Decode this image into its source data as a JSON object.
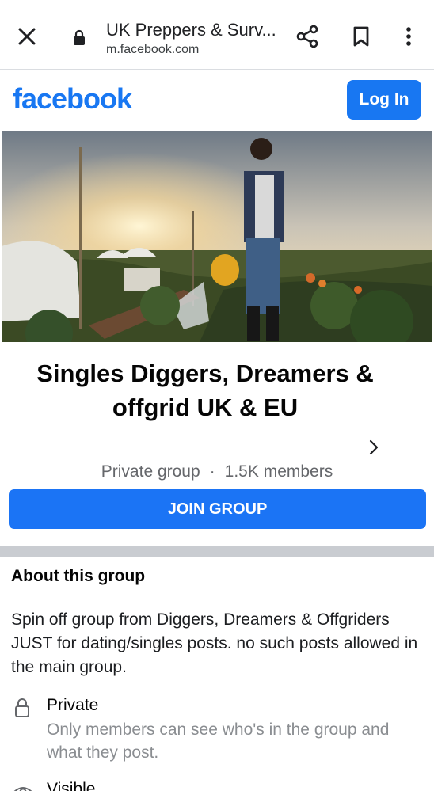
{
  "browser": {
    "title": "UK Preppers & Surv...",
    "url": "m.facebook.com",
    "icons": [
      "close-icon",
      "lock-icon",
      "share-icon",
      "bookmark-icon",
      "more-vert-icon"
    ]
  },
  "header": {
    "logo_text": "facebook",
    "login_label": "Log In",
    "brand_color": "#1877f2"
  },
  "group": {
    "title": "Singles Diggers, Dreamers & offgrid UK & EU",
    "privacy": "Private group",
    "separator": "·",
    "members": "1.5K members",
    "join_label": "JOIN GROUP"
  },
  "about": {
    "heading": "About this group",
    "description": "Spin off group from Diggers, Dreamers & Offgriders JUST for dating/singles posts. no such posts allowed in the main group.",
    "private_title": "Private",
    "private_desc": "Only members can see who's in the group and what they post.",
    "visible_title": "Visible"
  }
}
